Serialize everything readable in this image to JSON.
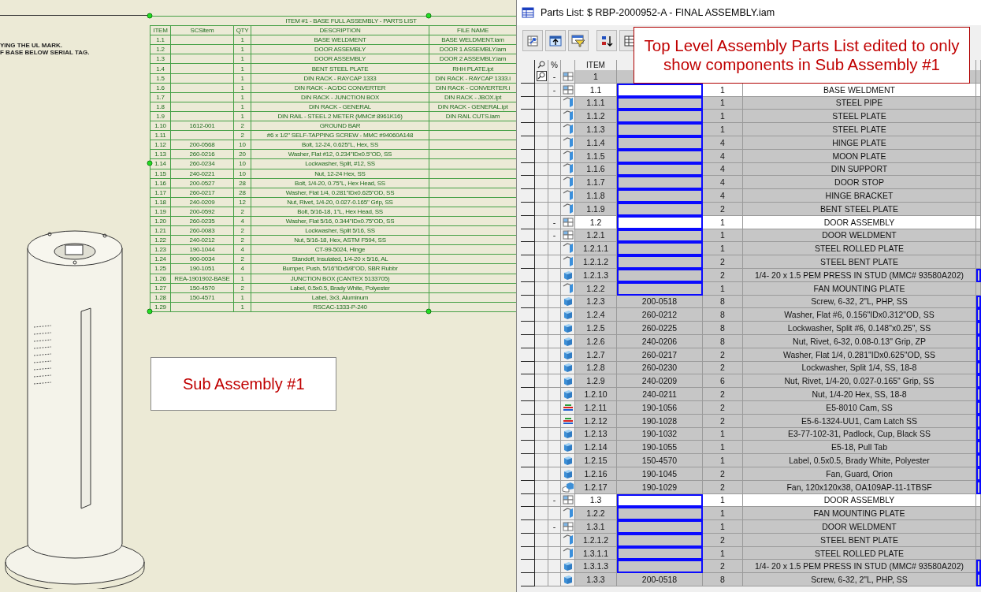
{
  "sheet": {
    "notes": [
      "YING THE UL MARK.",
      "F BASE BELOW SERIAL TAG."
    ],
    "parts_list": {
      "title": "ITEM #1 - BASE FULL ASSEMBLY - PARTS LIST",
      "columns": [
        "ITEM",
        "SCSitem",
        "QTY",
        "DESCRIPTION",
        "FILE NAME"
      ],
      "rows": [
        {
          "item": "1.1",
          "qty": "1",
          "description": "BASE WELDMENT",
          "file": "BASE WELDMENT.iam"
        },
        {
          "item": "1.2",
          "qty": "1",
          "description": "DOOR ASSEMBLY",
          "file": "DOOR 1 ASSEMBLY.iam"
        },
        {
          "item": "1.3",
          "qty": "1",
          "description": "DOOR ASSEMBLY",
          "file": "DOOR 2 ASSEMBLY.iam"
        },
        {
          "item": "1.4",
          "qty": "1",
          "description": "BENT STEEL PLATE",
          "file": "RHH PLATE.ipt"
        },
        {
          "item": "1.5",
          "qty": "1",
          "description": "DIN RACK - RAYCAP 1333",
          "file": "DIN RACK - RAYCAP 1333.i"
        },
        {
          "item": "1.6",
          "qty": "1",
          "description": "DIN RACK - AC/DC CONVERTER",
          "file": "DIN RACK - CONVERTER.i"
        },
        {
          "item": "1.7",
          "qty": "1",
          "description": "DIN RACK - JUNCTION BOX",
          "file": "DIN RACK - JBOX.ipt"
        },
        {
          "item": "1.8",
          "qty": "1",
          "description": "DIN RACK - GENERAL",
          "file": "DIN RACK - GENERAL.ipt"
        },
        {
          "item": "1.9",
          "qty": "1",
          "description": "DIN RAIL - STEEL 2 METER (MMC# 8961K16)",
          "file": "DIN RAIL CUTS.iam"
        },
        {
          "item": "1.10",
          "scs": "1612-001",
          "qty": "2",
          "description": "GROUND BAR"
        },
        {
          "item": "1.11",
          "qty": "2",
          "description": "#6 x 1/2\" SELF-TAPPING SCREW - MMC #94060A148"
        },
        {
          "item": "1.12",
          "scs": "200-0568",
          "qty": "10",
          "description": "Bolt, 12-24, 0.625\"L, Hex, SS"
        },
        {
          "item": "1.13",
          "scs": "260-0216",
          "qty": "20",
          "description": "Washer, Flat #12, 0.234\"IDx0.5\"OD, SS"
        },
        {
          "item": "1.14",
          "scs": "260-0234",
          "qty": "10",
          "description": "Lockwasher, Split, #12, SS"
        },
        {
          "item": "1.15",
          "scs": "240-0221",
          "qty": "10",
          "description": "Nut, 12-24 Hex, SS"
        },
        {
          "item": "1.16",
          "scs": "200-0527",
          "qty": "28",
          "description": "Bolt, 1/4-20, 0.75\"L, Hex Head, SS"
        },
        {
          "item": "1.17",
          "scs": "260-0217",
          "qty": "28",
          "description": "Washer, Flat 1/4, 0.281\"IDx0.625\"OD, SS"
        },
        {
          "item": "1.18",
          "scs": "240-0209",
          "qty": "12",
          "description": "Nut, Rivet, 1/4-20, 0.027-0.165\" Grip, SS"
        },
        {
          "item": "1.19",
          "scs": "200-0592",
          "qty": "2",
          "description": "Bolt, 5/16-18, 1\"L, Hex Head, SS"
        },
        {
          "item": "1.20",
          "scs": "260-0235",
          "qty": "4",
          "description": "Washer, Flat 5/16, 0.344\"IDx0.75\"OD, SS"
        },
        {
          "item": "1.21",
          "scs": "260-0083",
          "qty": "2",
          "description": "Lockwasher, Split 5/16, SS"
        },
        {
          "item": "1.22",
          "scs": "240-0212",
          "qty": "2",
          "description": "Nut, 5/16-18, Hex, ASTM F594, SS"
        },
        {
          "item": "1.23",
          "scs": "190-1044",
          "qty": "4",
          "description": "CT-99-5024, Hinge"
        },
        {
          "item": "1.24",
          "scs": "900-0034",
          "qty": "2",
          "description": "Standoff, Insulated, 1/4-20 x 5/16, AL"
        },
        {
          "item": "1.25",
          "scs": "190-1051",
          "qty": "4",
          "description": "Bumper, Push, 5/16\"IDx5/8\"OD, SBR Rubbr"
        },
        {
          "item": "1.26",
          "scs": "REA-1901902-BASE",
          "qty": "1",
          "description": "JUNCTION BOX (CANTEX 5133705)"
        },
        {
          "item": "1.27",
          "scs": "150-4570",
          "qty": "2",
          "description": "Label, 0.5x0.5, Brady White, Polyester"
        },
        {
          "item": "1.28",
          "scs": "150-4571",
          "qty": "1",
          "description": "Label, 3x3, Aluminum"
        },
        {
          "item": "1.29",
          "qty": "1",
          "description": "RSCAC-1333-P-240"
        }
      ]
    },
    "callout": "Sub Assembly #1"
  },
  "window": {
    "title": "Parts List: $ RBP-2000952-A - FINAL ASSEMBLY.iam",
    "callout": "Top Level Assembly Parts List edited to only show components in Sub Assembly #1",
    "table": {
      "symbol_heading": "%",
      "item_heading": "ITEM",
      "top_row": {
        "toggle": "-",
        "item": "1"
      },
      "rows": [
        {
          "kind": "assembly",
          "shaded": false,
          "toggle": "-",
          "item": "1.1",
          "qty": "1",
          "description": "BASE WELDMENT"
        },
        {
          "kind": "sheet",
          "shaded": true,
          "item": "1.1.1",
          "qty": "1",
          "description": "STEEL PIPE"
        },
        {
          "kind": "sheet",
          "shaded": true,
          "item": "1.1.2",
          "qty": "1",
          "description": "STEEL PLATE"
        },
        {
          "kind": "sheet",
          "shaded": true,
          "item": "1.1.3",
          "qty": "1",
          "description": "STEEL PLATE"
        },
        {
          "kind": "sheet",
          "shaded": true,
          "item": "1.1.4",
          "qty": "4",
          "description": "HINGE PLATE"
        },
        {
          "kind": "sheet",
          "shaded": true,
          "item": "1.1.5",
          "qty": "4",
          "description": "MOON PLATE"
        },
        {
          "kind": "sheet",
          "shaded": true,
          "item": "1.1.6",
          "qty": "4",
          "description": "DIN SUPPORT"
        },
        {
          "kind": "sheet",
          "shaded": true,
          "item": "1.1.7",
          "qty": "4",
          "description": "DOOR STOP"
        },
        {
          "kind": "sheet",
          "shaded": true,
          "item": "1.1.8",
          "qty": "4",
          "description": "HINGE BRACKET"
        },
        {
          "kind": "sheet",
          "shaded": true,
          "item": "1.1.9",
          "qty": "2",
          "description": "BENT STEEL PLATE"
        },
        {
          "kind": "assembly",
          "shaded": false,
          "toggle": "-",
          "item": "1.2",
          "qty": "1",
          "description": "DOOR ASSEMBLY"
        },
        {
          "kind": "assembly",
          "shaded": true,
          "toggle": "-",
          "item": "1.2.1",
          "qty": "1",
          "description": "DOOR WELDMENT"
        },
        {
          "kind": "sheet",
          "shaded": true,
          "item": "1.2.1.1",
          "qty": "1",
          "description": "STEEL ROLLED PLATE"
        },
        {
          "kind": "sheet",
          "shaded": true,
          "item": "1.2.1.2",
          "qty": "2",
          "description": "STEEL BENT PLATE"
        },
        {
          "kind": "part",
          "shaded": true,
          "item": "1.2.1.3",
          "qty": "2",
          "description": "1/4- 20 x 1.5 PEM PRESS IN STUD (MMC# 93580A202)"
        },
        {
          "kind": "sheet",
          "shaded": true,
          "item": "1.2.2",
          "qty": "1",
          "description": "FAN MOUNTING PLATE"
        },
        {
          "kind": "part",
          "shaded": true,
          "item": "1.2.3",
          "scs": "200-0518",
          "qty": "8",
          "description": "Screw, 6-32, 2\"L, PHP, SS"
        },
        {
          "kind": "part",
          "shaded": true,
          "item": "1.2.4",
          "scs": "260-0212",
          "qty": "8",
          "description": "Washer, Flat #6, 0.156\"IDx0.312\"OD, SS"
        },
        {
          "kind": "part",
          "shaded": true,
          "item": "1.2.5",
          "scs": "260-0225",
          "qty": "8",
          "description": "Lockwasher, Split #6, 0.148\"x0.25\", SS"
        },
        {
          "kind": "part",
          "shaded": true,
          "item": "1.2.6",
          "scs": "240-0206",
          "qty": "8",
          "description": "Nut, Rivet, 6-32, 0.08-0.13\" Grip, ZP"
        },
        {
          "kind": "part",
          "shaded": true,
          "item": "1.2.7",
          "scs": "260-0217",
          "qty": "2",
          "description": "Washer, Flat 1/4, 0.281\"IDx0.625\"OD, SS"
        },
        {
          "kind": "part",
          "shaded": true,
          "item": "1.2.8",
          "scs": "260-0230",
          "qty": "2",
          "description": "Lockwasher, Split 1/4, SS, 18-8"
        },
        {
          "kind": "part",
          "shaded": true,
          "item": "1.2.9",
          "scs": "240-0209",
          "qty": "6",
          "description": "Nut, Rivet, 1/4-20, 0.027-0.165\" Grip, SS"
        },
        {
          "kind": "part",
          "shaded": true,
          "item": "1.2.10",
          "scs": "240-0211",
          "qty": "2",
          "description": "Nut, 1/4-20 Hex, SS, 18-8"
        },
        {
          "kind": "cam",
          "shaded": true,
          "item": "1.2.11",
          "scs": "190-1056",
          "qty": "2",
          "description": "E5-8010 Cam, SS"
        },
        {
          "kind": "cam",
          "shaded": true,
          "item": "1.2.12",
          "scs": "190-1028",
          "qty": "2",
          "description": "E5-6-1324-UU1, Cam Latch SS"
        },
        {
          "kind": "part",
          "shaded": true,
          "item": "1.2.13",
          "scs": "190-1032",
          "qty": "1",
          "description": "E3-77-102-31, Padlock, Cup, Black SS"
        },
        {
          "kind": "part",
          "shaded": true,
          "item": "1.2.14",
          "scs": "190-1055",
          "qty": "1",
          "description": "E5-18, Pull Tab"
        },
        {
          "kind": "part",
          "shaded": true,
          "item": "1.2.15",
          "scs": "150-4570",
          "qty": "1",
          "description": "Label, 0.5x0.5, Brady White, Polyester"
        },
        {
          "kind": "part",
          "shaded": true,
          "item": "1.2.16",
          "scs": "190-1045",
          "qty": "2",
          "description": "Fan, Guard, Orion"
        },
        {
          "kind": "multi",
          "shaded": true,
          "item": "1.2.17",
          "scs": "190-1029",
          "qty": "2",
          "description": "Fan, 120x120x38, OA109AP-11-1TBSF"
        },
        {
          "kind": "assembly",
          "shaded": false,
          "toggle": "-",
          "item": "1.3",
          "qty": "1",
          "description": "DOOR ASSEMBLY"
        },
        {
          "kind": "sheet",
          "shaded": true,
          "item": "1.2.2",
          "qty": "1",
          "description": "FAN MOUNTING PLATE"
        },
        {
          "kind": "assembly",
          "shaded": true,
          "toggle": "-",
          "item": "1.3.1",
          "qty": "1",
          "description": "DOOR WELDMENT"
        },
        {
          "kind": "sheet",
          "shaded": true,
          "item": "1.2.1.2",
          "qty": "2",
          "description": "STEEL BENT PLATE"
        },
        {
          "kind": "sheet",
          "shaded": true,
          "item": "1.3.1.1",
          "qty": "1",
          "description": "STEEL ROLLED PLATE"
        },
        {
          "kind": "part",
          "shaded": true,
          "item": "1.3.1.3",
          "qty": "2",
          "description": "1/4- 20 x 1.5 PEM PRESS IN STUD (MMC# 93580A202)"
        },
        {
          "kind": "part",
          "shaded": true,
          "item": "1.3.3",
          "scs": "200-0518",
          "qty": "8",
          "description": "Screw, 6-32, 2\"L, PHP, SS"
        }
      ]
    }
  }
}
